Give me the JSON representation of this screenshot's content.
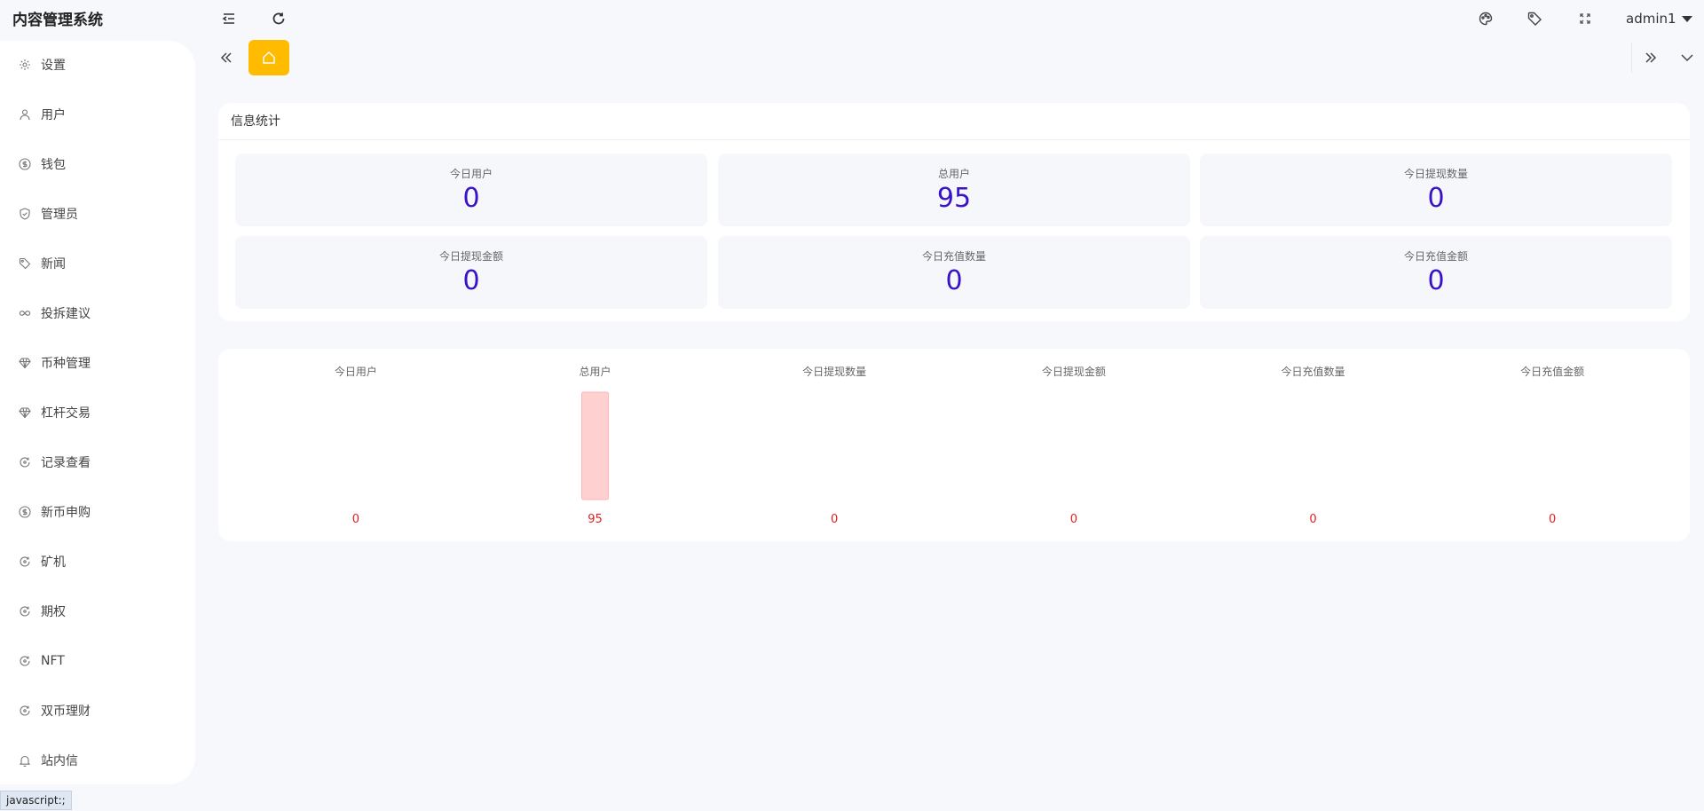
{
  "app": {
    "title": "内容管理系统"
  },
  "header": {
    "icons": [
      "menu-fold-icon",
      "refresh-icon",
      "palette-icon",
      "tag-icon",
      "fullscreen-icon"
    ],
    "user": {
      "name": "admin1"
    }
  },
  "sidebar": {
    "items": [
      {
        "label": "设置",
        "icon": "gear-icon"
      },
      {
        "label": "用户",
        "icon": "user-icon"
      },
      {
        "label": "钱包",
        "icon": "dollar-circle-icon"
      },
      {
        "label": "管理员",
        "icon": "shield-check-icon"
      },
      {
        "label": "新闻",
        "icon": "tag-icon"
      },
      {
        "label": "投拆建议",
        "icon": "infinity-icon"
      },
      {
        "label": "币种管理",
        "icon": "diamond-icon"
      },
      {
        "label": "杠杆交易",
        "icon": "diamond-icon"
      },
      {
        "label": "记录查看",
        "icon": "cycle-icon"
      },
      {
        "label": "新币申购",
        "icon": "dollar-circle-icon"
      },
      {
        "label": "矿机",
        "icon": "cycle-icon"
      },
      {
        "label": "期权",
        "icon": "cycle-icon"
      },
      {
        "label": "NFT",
        "icon": "cycle-icon"
      },
      {
        "label": "双币理财",
        "icon": "cycle-icon"
      },
      {
        "label": "站内信",
        "icon": "bell-icon"
      }
    ]
  },
  "tabs": {
    "home_icon": "home-icon"
  },
  "stats": {
    "title": "信息统计",
    "items": [
      {
        "label": "今日用户",
        "value": "0"
      },
      {
        "label": "总用户",
        "value": "95"
      },
      {
        "label": "今日提现数量",
        "value": "0"
      },
      {
        "label": "今日提现金额",
        "value": "0"
      },
      {
        "label": "今日充值数量",
        "value": "0"
      },
      {
        "label": "今日充值金额",
        "value": "0"
      }
    ]
  },
  "chart_data": {
    "type": "bar",
    "categories": [
      "今日用户",
      "总用户",
      "今日提现数量",
      "今日提现金额",
      "今日充值数量",
      "今日充值金额"
    ],
    "values": [
      0,
      95,
      0,
      0,
      0,
      0
    ],
    "data_labels": [
      "0",
      "95",
      "0",
      "0",
      "0",
      "0"
    ],
    "title": "",
    "xlabel": "",
    "ylabel": "",
    "ylim": [
      0,
      95
    ],
    "grid": false,
    "legend": "none",
    "colors": {
      "bar": "#ffd0d0",
      "bar_stroke": "#ffb3b3",
      "value_label": "#e02020",
      "category_label": "#666666"
    }
  },
  "statusbar": {
    "text": "javascript:;"
  },
  "colors": {
    "accent": "#3a12c8",
    "home_tab": "#ffbb00",
    "background": "#f7f8fc"
  }
}
